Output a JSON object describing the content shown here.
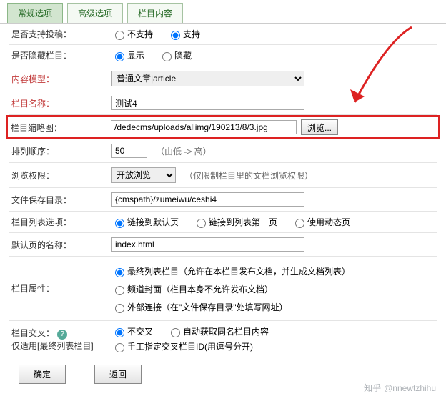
{
  "tabs": {
    "t0": "常规选项",
    "t1": "高级选项",
    "t2": "栏目内容"
  },
  "rows": {
    "post": {
      "label": "是否支持投稿：",
      "opt_no": "不支持",
      "opt_yes": "支持"
    },
    "hide": {
      "label": "是否隐藏栏目：",
      "opt_show": "显示",
      "opt_hide": "隐藏"
    },
    "model": {
      "label": "内容模型：",
      "value": "普通文章|article"
    },
    "name": {
      "label": "栏目名称：",
      "value": "测试4"
    },
    "thumb": {
      "label": "栏目缩略图：",
      "value": "/dedecms/uploads/allimg/190213/8/3.jpg",
      "browse": "浏览..."
    },
    "sort": {
      "label": "排列顺序：",
      "value": "50",
      "hint": "（由低 -> 高）"
    },
    "perm": {
      "label": "浏览权限：",
      "value": "开放浏览",
      "hint": "（仅限制栏目里的文档浏览权限）"
    },
    "savepath": {
      "label": "文件保存目录：",
      "value": "{cmspath}/zumeiwu/ceshi4"
    },
    "listopt": {
      "label": "栏目列表选项：",
      "opt1": "链接到默认页",
      "opt2": "链接到列表第一页",
      "opt3": "使用动态页"
    },
    "defpage": {
      "label": "默认页的名称：",
      "value": "index.html"
    },
    "attr": {
      "label": "栏目属性：",
      "opt1": "最终列表栏目（允许在本栏目发布文档，并生成文档列表）",
      "opt2": "频道封面（栏目本身不允许发布文档）",
      "opt3": "外部连接（在\"文件保存目录\"处填写网址）"
    },
    "cross": {
      "label1": "栏目交叉：",
      "label2": "仅适用[最终列表栏目]",
      "opt1": "不交叉",
      "opt2": "自动获取同名栏目内容",
      "opt3": "手工指定交叉栏目ID(用逗号分开)"
    }
  },
  "buttons": {
    "ok": "确定",
    "back": "返回"
  },
  "watermark": "@nnewtzhihu"
}
